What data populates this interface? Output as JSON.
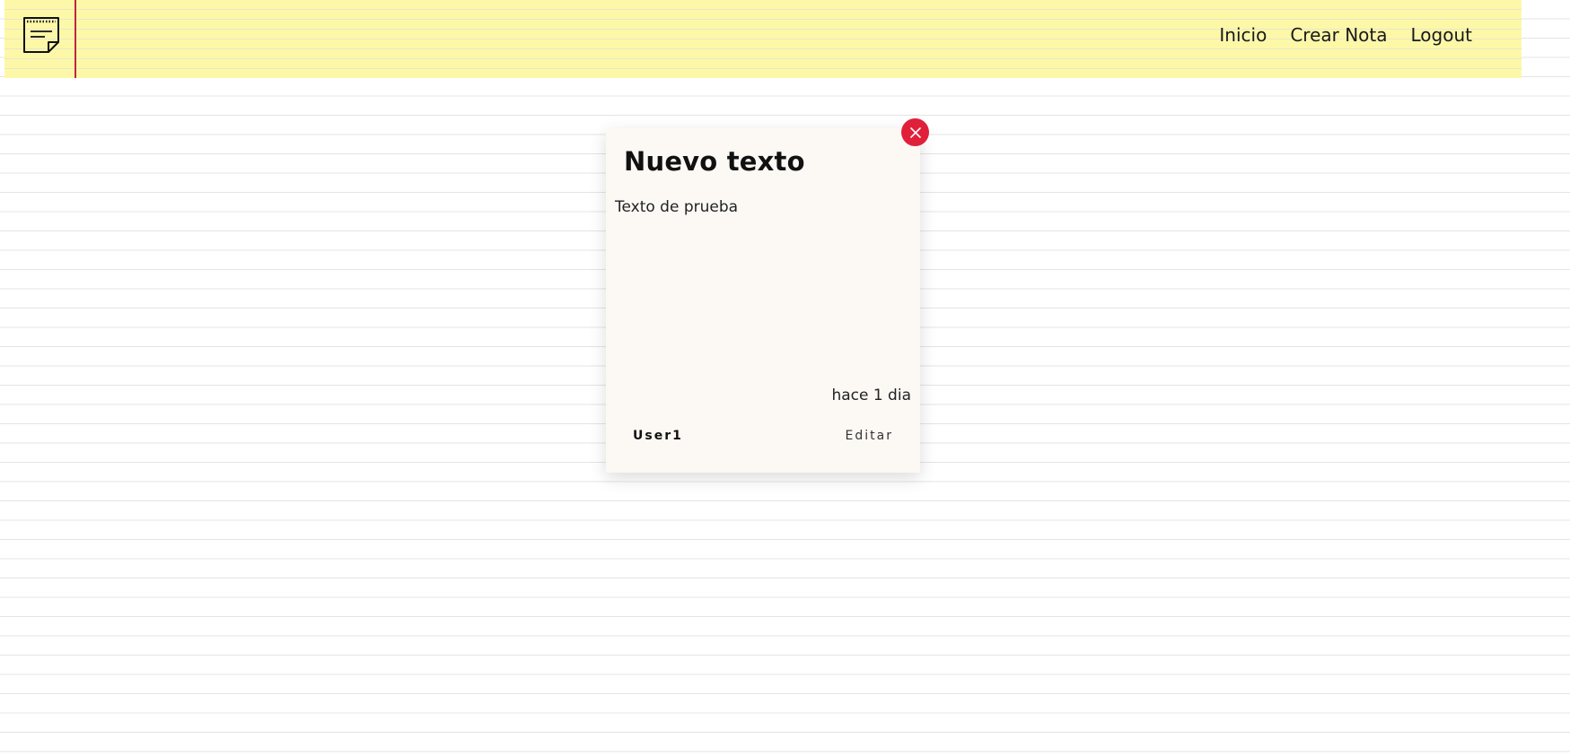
{
  "nav": {
    "logo_icon": "sticky-note-icon",
    "links": [
      "Inicio",
      "Crear Nota",
      "Logout"
    ]
  },
  "note": {
    "title": "Nuevo texto",
    "body": "Texto de prueba",
    "time": "hace 1 dia",
    "user": "User1",
    "edit_label": "Editar",
    "close_icon": "close-icon"
  },
  "colors": {
    "navbar_bg": "#fdf8a8",
    "margin_line": "#c0263a",
    "close_button": "#e0203a",
    "card_bg": "#fcf9f5"
  }
}
